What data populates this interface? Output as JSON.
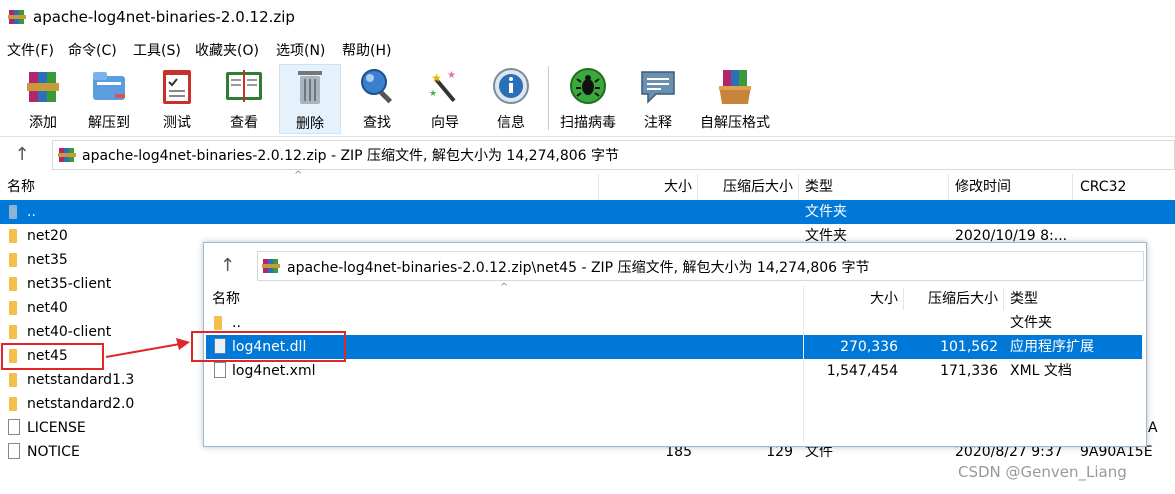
{
  "window": {
    "title": "apache-log4net-binaries-2.0.12.zip"
  },
  "menu": [
    "文件(F)",
    "命令(C)",
    "工具(S)",
    "收藏夹(O)",
    "选项(N)",
    "帮助(H)"
  ],
  "toolbar": [
    {
      "label": "添加",
      "icon": "add-books-icon"
    },
    {
      "label": "解压到",
      "icon": "extract-folder-icon"
    },
    {
      "label": "测试",
      "icon": "test-clipboard-icon"
    },
    {
      "label": "查看",
      "icon": "view-book-icon"
    },
    {
      "label": "删除",
      "icon": "trash-icon"
    },
    {
      "label": "查找",
      "icon": "magnifier-icon"
    },
    {
      "label": "向导",
      "icon": "wizard-wand-icon"
    },
    {
      "label": "信息",
      "icon": "info-icon"
    },
    {
      "label": "扫描病毒",
      "icon": "virus-scan-icon"
    },
    {
      "label": "注释",
      "icon": "comment-icon"
    },
    {
      "label": "自解压格式",
      "icon": "sfx-box-icon"
    }
  ],
  "address": {
    "path": "apache-log4net-binaries-2.0.12.zip - ZIP 压缩文件, 解包大小为 14,274,806 字节"
  },
  "columns": {
    "name": "名称",
    "size": "大小",
    "packed": "压缩后大小",
    "type": "类型",
    "modified": "修改时间",
    "crc": "CRC32"
  },
  "files": [
    {
      "name": "..",
      "size": "",
      "packed": "",
      "type": "文件夹",
      "modified": "",
      "crc": "",
      "kind": "up"
    },
    {
      "name": "net20",
      "size": "",
      "packed": "",
      "type": "文件夹",
      "modified": "2020/10/19 8:...",
      "crc": "",
      "kind": "folder"
    },
    {
      "name": "net35",
      "size": "",
      "packed": "",
      "type": "",
      "modified": "",
      "crc": "",
      "kind": "folder"
    },
    {
      "name": "net35-client",
      "size": "",
      "packed": "",
      "type": "",
      "modified": "",
      "crc": "",
      "kind": "folder"
    },
    {
      "name": "net40",
      "size": "",
      "packed": "",
      "type": "",
      "modified": "",
      "crc": "",
      "kind": "folder"
    },
    {
      "name": "net40-client",
      "size": "",
      "packed": "",
      "type": "",
      "modified": "",
      "crc": "",
      "kind": "folder"
    },
    {
      "name": "net45",
      "size": "",
      "packed": "",
      "type": "",
      "modified": "",
      "crc": "",
      "kind": "folder"
    },
    {
      "name": "netstandard1.3",
      "size": "",
      "packed": "",
      "type": "",
      "modified": "",
      "crc": "",
      "kind": "folder"
    },
    {
      "name": "netstandard2.0",
      "size": "",
      "packed": "",
      "type": "",
      "modified": "",
      "crc": "",
      "kind": "folder"
    },
    {
      "name": "LICENSE",
      "size": "",
      "packed": "",
      "type": "",
      "modified": "",
      "crc": "A",
      "kind": "file"
    },
    {
      "name": "NOTICE",
      "size": "185",
      "packed": "129",
      "type": "文件",
      "modified": "2020/8/27 9:37",
      "crc": "9A90A15E",
      "kind": "file"
    }
  ],
  "popup": {
    "path": "apache-log4net-binaries-2.0.12.zip\\net45 - ZIP 压缩文件, 解包大小为 14,274,806 字节",
    "columns": {
      "name": "名称",
      "size": "大小",
      "packed": "压缩后大小",
      "type": "类型"
    },
    "files": [
      {
        "name": "..",
        "size": "",
        "packed": "",
        "type": "文件夹",
        "kind": "folder"
      },
      {
        "name": "log4net.dll",
        "size": "270,336",
        "packed": "101,562",
        "type": "应用程序扩展",
        "kind": "dll"
      },
      {
        "name": "log4net.xml",
        "size": "1,547,454",
        "packed": "171,336",
        "type": "XML 文档",
        "kind": "file"
      }
    ]
  },
  "watermark": "CSDN @Genven_Liang",
  "colors": {
    "selection": "#0078d7",
    "annotation": "#e0262b",
    "folder": "#f2c04b"
  }
}
